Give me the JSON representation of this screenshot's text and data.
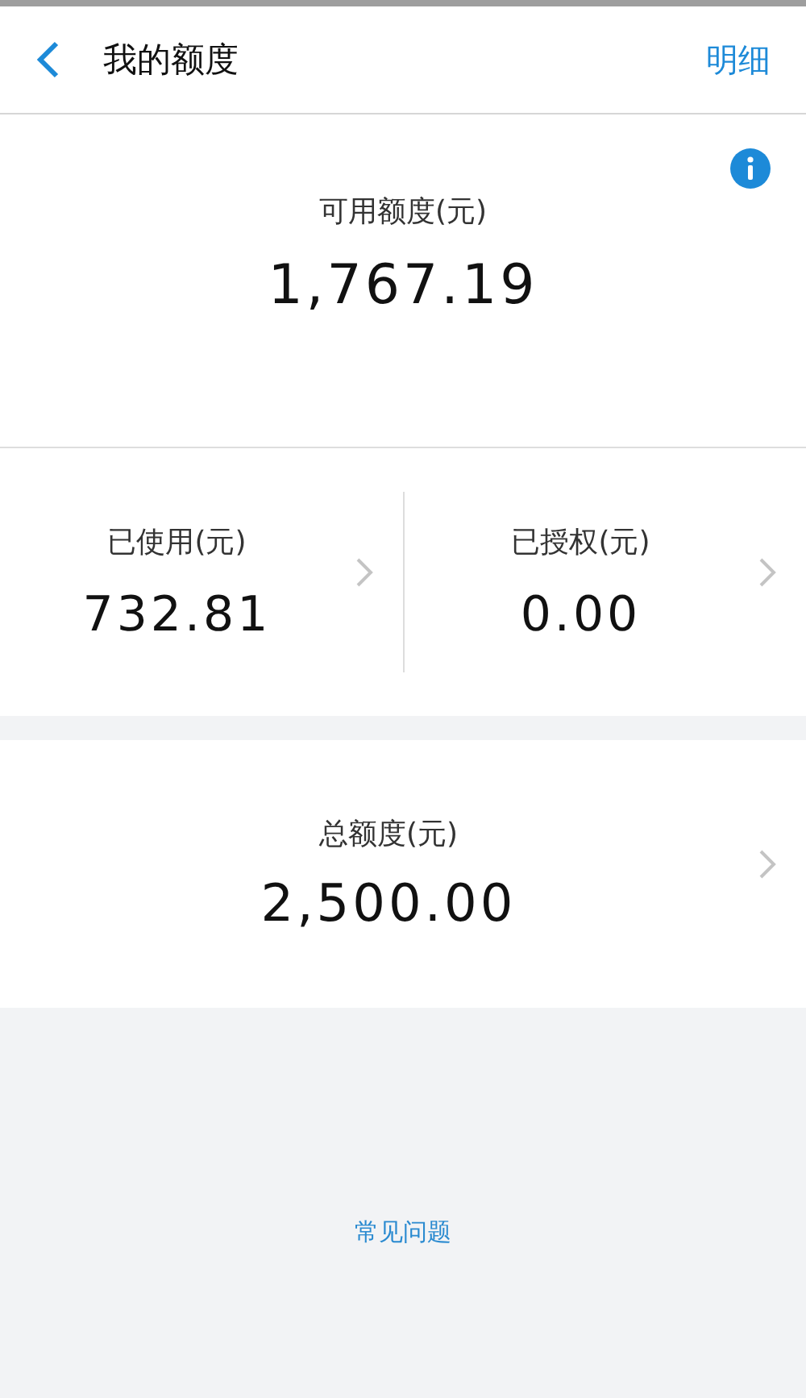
{
  "header": {
    "title": "我的额度",
    "action": "明细"
  },
  "available": {
    "label": "可用额度(元)",
    "amount": "1,767.19"
  },
  "split": [
    {
      "label": "已使用(元)",
      "amount": "732.81"
    },
    {
      "label": "已授权(元)",
      "amount": "0.00"
    }
  ],
  "total": {
    "label": "总额度(元)",
    "amount": "2,500.00"
  },
  "faq_link": "常见问题"
}
